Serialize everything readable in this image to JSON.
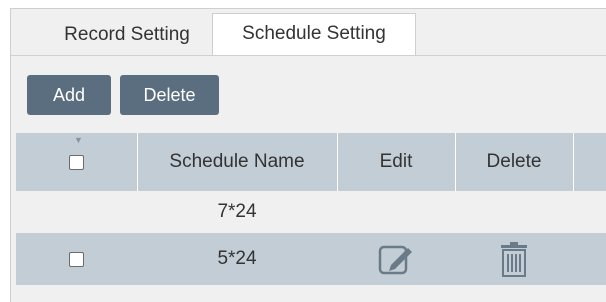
{
  "tabs": [
    {
      "label": "Record Setting"
    },
    {
      "label": "Schedule Setting"
    }
  ],
  "toolbar": {
    "add_label": "Add",
    "delete_label": "Delete"
  },
  "table": {
    "headers": {
      "name": "Schedule Name",
      "edit": "Edit",
      "delete": "Delete"
    },
    "rows": [
      {
        "name": "7*24"
      },
      {
        "name": "5*24"
      }
    ]
  },
  "icons": {
    "edit": "edit-pencil-icon",
    "delete": "trash-icon",
    "sort": "sort-down-icon"
  },
  "colors": {
    "header_bg": "#c3cdd6",
    "button_bg": "#5b6e7f",
    "icon": "#6b7a87"
  }
}
